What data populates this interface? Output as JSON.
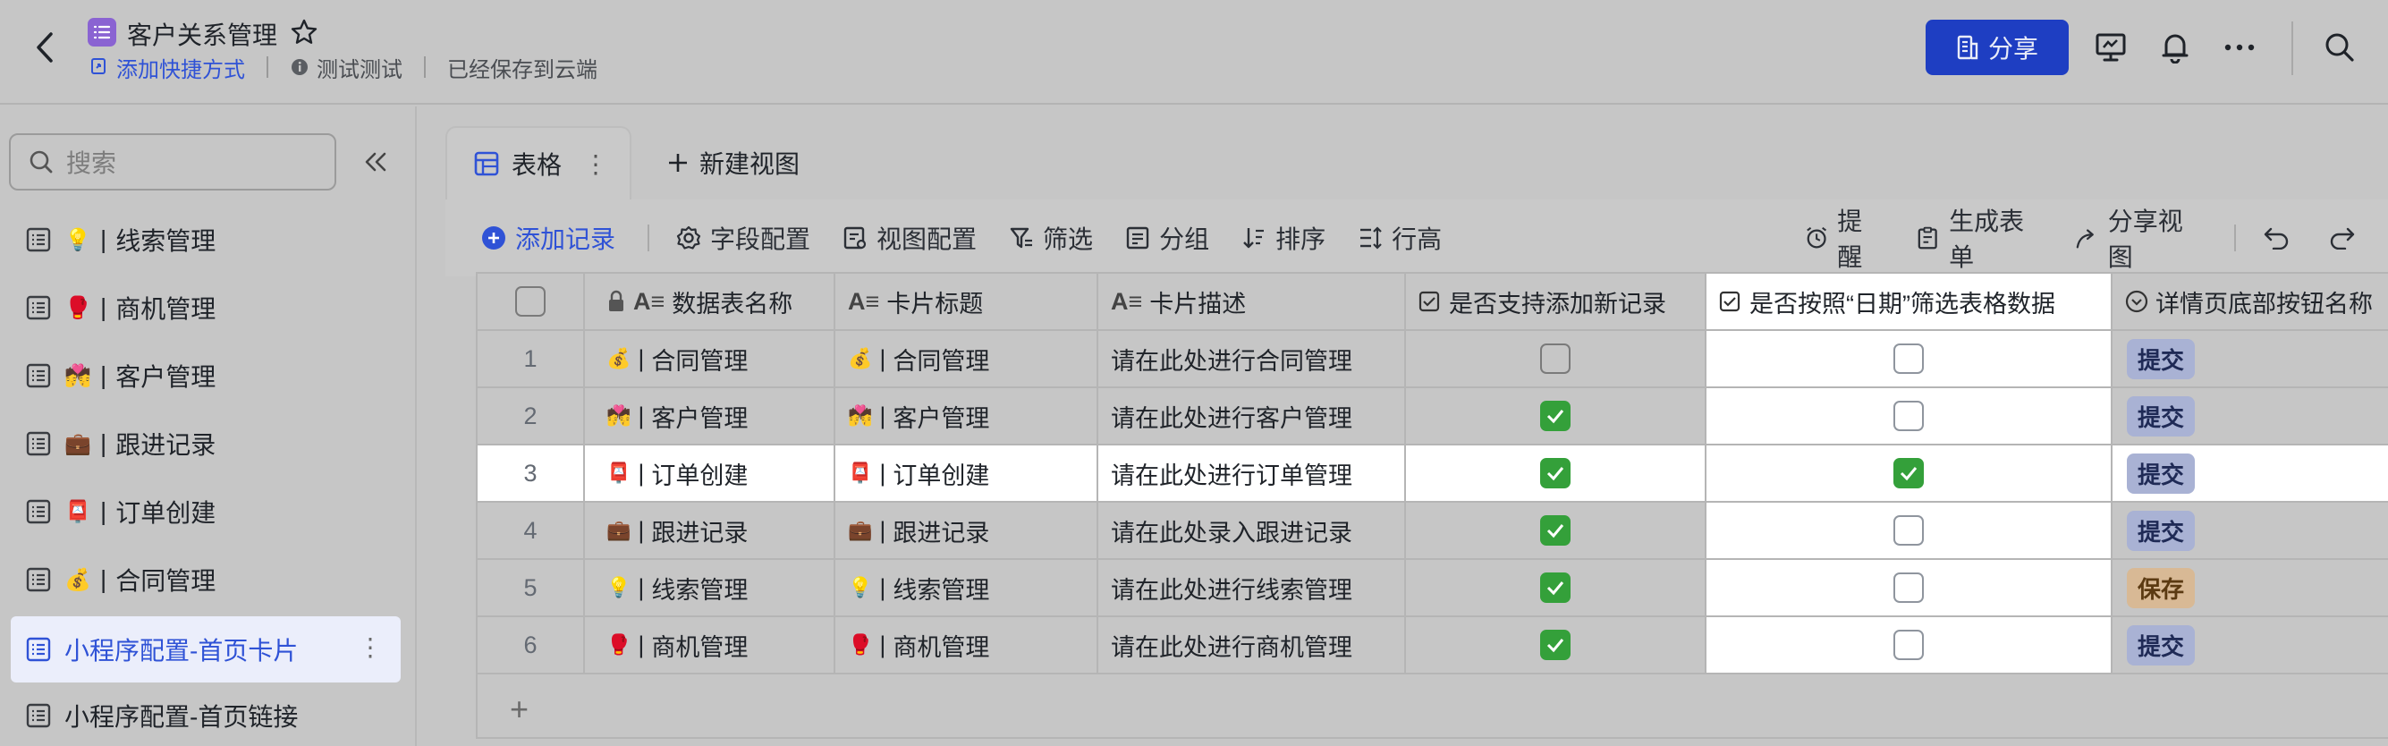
{
  "header": {
    "title": "客户关系管理",
    "add_shortcut": "添加快捷方式",
    "info_label": "测试测试",
    "saved_status": "已经保存到云端",
    "share_label": "分享"
  },
  "sidebar": {
    "search_placeholder": "搜索",
    "items": [
      {
        "emoji": "💡",
        "label": "线索管理"
      },
      {
        "emoji": "🥊",
        "label": "商机管理"
      },
      {
        "emoji": "💏",
        "label": "客户管理"
      },
      {
        "emoji": "💼",
        "label": "跟进记录"
      },
      {
        "emoji": "📮",
        "label": "订单创建"
      },
      {
        "emoji": "💰",
        "label": "合同管理"
      },
      {
        "emoji": "",
        "label": "小程序配置-首页卡片"
      },
      {
        "emoji": "",
        "label": "小程序配置-首页链接"
      }
    ],
    "separator": "|"
  },
  "tabs": {
    "active_label": "表格",
    "new_view_label": "新建视图"
  },
  "toolbar": {
    "add_record": "添加记录",
    "field_config": "字段配置",
    "view_config": "视图配置",
    "filter": "筛选",
    "group": "分组",
    "sort": "排序",
    "row_height": "行高",
    "remind": "提醒",
    "gen_form": "生成表单",
    "share_view": "分享视图"
  },
  "table": {
    "columns": [
      "数据表名称",
      "卡片标题",
      "卡片描述",
      "是否支持添加新记录",
      "是否按照“日期”筛选表格数据",
      "详情页底部按钮名称"
    ],
    "rows": [
      {
        "num": "1",
        "emoji": "💰",
        "name": "合同管理",
        "title": "合同管理",
        "desc": "请在此处进行合同管理",
        "support_add": false,
        "date_filter": false,
        "button": "提交",
        "tag": "blue"
      },
      {
        "num": "2",
        "emoji": "💏",
        "name": "客户管理",
        "title": "客户管理",
        "desc": "请在此处进行客户管理",
        "support_add": true,
        "date_filter": false,
        "button": "提交",
        "tag": "blue"
      },
      {
        "num": "3",
        "emoji": "📮",
        "name": "订单创建",
        "title": "订单创建",
        "desc": "请在此处进行订单管理",
        "support_add": true,
        "date_filter": true,
        "button": "提交",
        "tag": "blue"
      },
      {
        "num": "4",
        "emoji": "💼",
        "name": "跟进记录",
        "title": "跟进记录",
        "desc": "请在此处录入跟进记录",
        "support_add": true,
        "date_filter": false,
        "button": "提交",
        "tag": "blue"
      },
      {
        "num": "5",
        "emoji": "💡",
        "name": "线索管理",
        "title": "线索管理",
        "desc": "请在此处进行线索管理",
        "support_add": true,
        "date_filter": false,
        "button": "保存",
        "tag": "orange"
      },
      {
        "num": "6",
        "emoji": "🥊",
        "name": "商机管理",
        "title": "商机管理",
        "desc": "请在此处进行商机管理",
        "support_add": true,
        "date_filter": false,
        "button": "提交",
        "tag": "blue"
      }
    ]
  }
}
